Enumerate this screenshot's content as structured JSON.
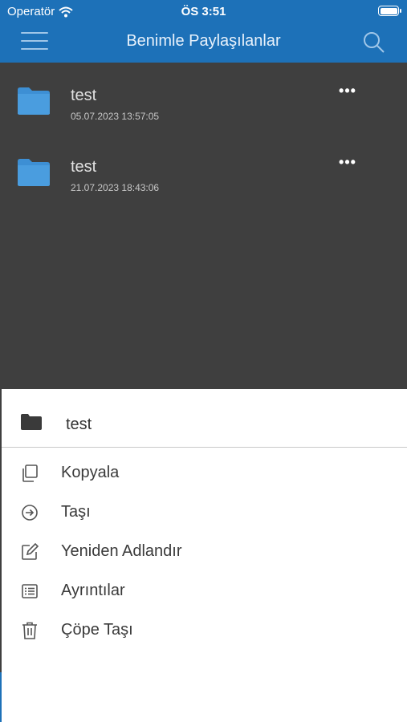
{
  "status_bar": {
    "carrier": "Operatör",
    "time": "ÖS 3:51"
  },
  "nav": {
    "title": "Benimle Paylaşılanlar"
  },
  "files": [
    {
      "name": "test",
      "date": "05.07.2023 13:57:05"
    },
    {
      "name": "test",
      "date": "21.07.2023 18:43:06"
    }
  ],
  "more_glyph": "•••",
  "sheet": {
    "title": "test",
    "actions": [
      {
        "label": "Kopyala",
        "icon": "copy-icon"
      },
      {
        "label": "Taşı",
        "icon": "move-icon"
      },
      {
        "label": "Yeniden Adlandır",
        "icon": "rename-icon"
      },
      {
        "label": "Ayrıntılar",
        "icon": "details-icon"
      },
      {
        "label": "Çöpe Taşı",
        "icon": "trash-icon"
      }
    ]
  },
  "colors": {
    "header": "#1d71b8",
    "dim_overlay": "#3f3f3f",
    "folder": "#3d8fd4"
  }
}
